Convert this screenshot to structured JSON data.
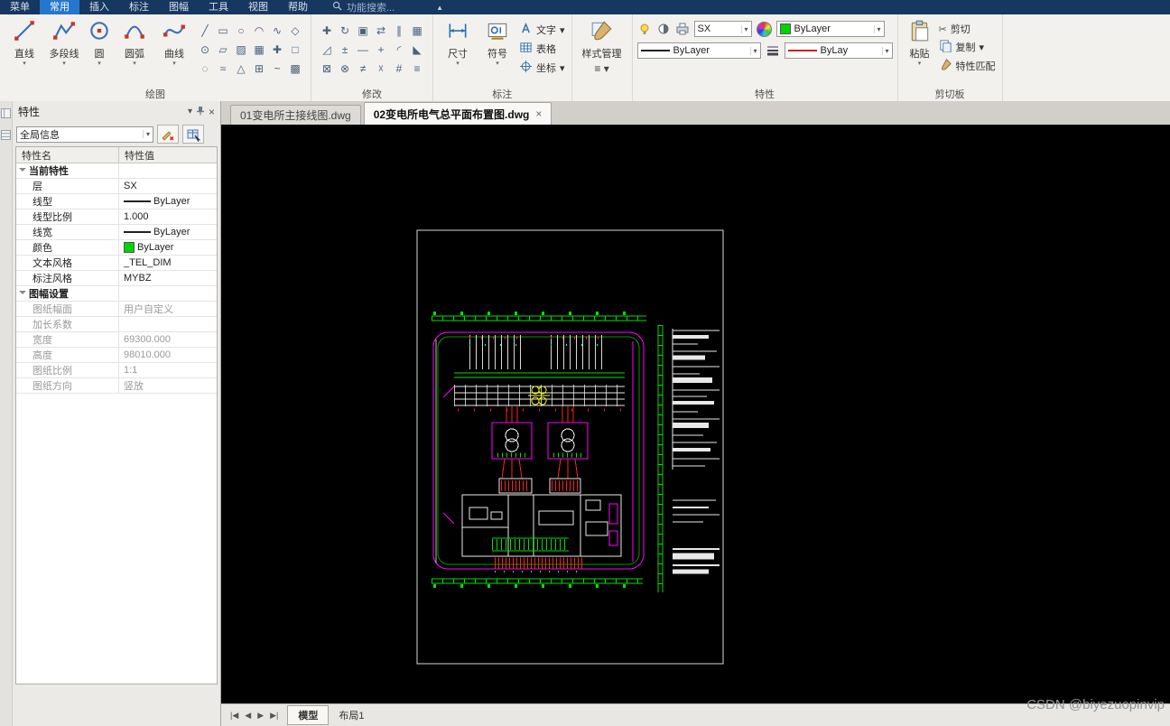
{
  "menubar": {
    "items": [
      {
        "label": "菜单"
      },
      {
        "label": "常用",
        "active": true
      },
      {
        "label": "插入"
      },
      {
        "label": "标注"
      },
      {
        "label": "图幅"
      },
      {
        "label": "工具"
      },
      {
        "label": "视图"
      },
      {
        "label": "帮助"
      }
    ],
    "search_placeholder": "功能搜索..."
  },
  "icons": {
    "dropdown": "▾",
    "close": "×",
    "collapse": "▲",
    "hamburger": "≡",
    "scissors": "✂",
    "nav_first": "|◀",
    "nav_prev": "◀",
    "nav_next": "▶",
    "nav_last": "▶|"
  },
  "ribbon": {
    "draw": {
      "label": "绘图",
      "buttons": [
        {
          "label": "直线"
        },
        {
          "label": "多段线"
        },
        {
          "label": "圆"
        },
        {
          "label": "圆弧"
        },
        {
          "label": "曲线"
        }
      ],
      "tools": [
        {
          "glyph": "╱",
          "name": "construction-line"
        },
        {
          "glyph": "▭",
          "name": "rectangle"
        },
        {
          "glyph": "○",
          "name": "donut"
        },
        {
          "glyph": "◠",
          "name": "revision-cloud"
        },
        {
          "glyph": "∿",
          "name": "spline"
        },
        {
          "glyph": "◇",
          "name": "polygon"
        },
        {
          "glyph": "⊙",
          "name": "point"
        },
        {
          "glyph": "▱",
          "name": "solid"
        },
        {
          "glyph": "▨",
          "name": "hatch"
        },
        {
          "glyph": "▦",
          "name": "table-draw"
        },
        {
          "glyph": "✚",
          "name": "cross-mark"
        },
        {
          "glyph": "□",
          "name": "block"
        },
        {
          "glyph": "◌",
          "name": "ellipse"
        },
        {
          "glyph": "≈",
          "name": "multiline"
        },
        {
          "glyph": "△",
          "name": "wipeout"
        },
        {
          "glyph": "⊞",
          "name": "region"
        },
        {
          "glyph": "~",
          "name": "freehand"
        },
        {
          "glyph": "▩",
          "name": "gradient"
        }
      ]
    },
    "modify": {
      "label": "修改",
      "tools": [
        {
          "glyph": "✚",
          "name": "move"
        },
        {
          "glyph": "↻",
          "name": "rotate"
        },
        {
          "glyph": "▣",
          "name": "copy"
        },
        {
          "glyph": "⇄",
          "name": "mirror"
        },
        {
          "glyph": "∥",
          "name": "offset"
        },
        {
          "glyph": "▦",
          "name": "array"
        },
        {
          "glyph": "◿",
          "name": "chamfer"
        },
        {
          "glyph": "±",
          "name": "lengthen"
        },
        {
          "glyph": "—",
          "name": "trim"
        },
        {
          "glyph": "+",
          "name": "extend"
        },
        {
          "glyph": "◜",
          "name": "fillet"
        },
        {
          "glyph": "◣",
          "name": "scale"
        },
        {
          "glyph": "⊠",
          "name": "erase"
        },
        {
          "glyph": "⊗",
          "name": "break"
        },
        {
          "glyph": "≠",
          "name": "stretch"
        },
        {
          "glyph": "☓",
          "name": "explode"
        },
        {
          "glyph": "#",
          "name": "divide"
        },
        {
          "glyph": "≡",
          "name": "join"
        }
      ]
    },
    "annotate": {
      "label": "标注",
      "dim_label": "尺寸",
      "symbol_label": "符号",
      "text_label": "文字",
      "table_label": "表格",
      "coord_label": "坐标"
    },
    "style_manager_label": "样式管理",
    "properties": {
      "label": "特性",
      "layer_value": "SX",
      "color_value": "ByLayer",
      "linetype_value": "ByLayer",
      "lineweight_value": "ByLay"
    },
    "clipboard": {
      "label": "剪切板",
      "paste_label": "粘贴",
      "cut_label": "剪切",
      "copy_label": "复制",
      "match_label": "特性匹配"
    }
  },
  "palette": {
    "title": "特性",
    "scope_value": "全局信息",
    "header": {
      "name": "特性名",
      "value": "特性值"
    },
    "rows": [
      {
        "type": "group",
        "name": "当前特性"
      },
      {
        "type": "item",
        "name": "层",
        "value": "SX"
      },
      {
        "type": "item",
        "name": "线型",
        "value": "ByLayer",
        "swatch": "line"
      },
      {
        "type": "item",
        "name": "线型比例",
        "value": "1.000"
      },
      {
        "type": "item",
        "name": "线宽",
        "value": "ByLayer",
        "swatch": "line"
      },
      {
        "type": "item",
        "name": "颜色",
        "value": "ByLayer",
        "swatch": "color",
        "swatch_color": "#00d400"
      },
      {
        "type": "item",
        "name": "文本风格",
        "value": "_TEL_DIM"
      },
      {
        "type": "item",
        "name": "标注风格",
        "value": "MYBZ"
      },
      {
        "type": "group",
        "name": "图幅设置"
      },
      {
        "type": "item",
        "name": "图纸幅面",
        "value": "用户自定义",
        "muted": true
      },
      {
        "type": "item",
        "name": "加长系数",
        "value": "",
        "muted": true
      },
      {
        "type": "item",
        "name": "宽度",
        "value": "69300.000",
        "muted": true
      },
      {
        "type": "item",
        "name": "高度",
        "value": "98010.000",
        "muted": true
      },
      {
        "type": "item",
        "name": "图纸比例",
        "value": "1:1",
        "muted": true
      },
      {
        "type": "item",
        "name": "图纸方向",
        "value": "竖放",
        "muted": true
      }
    ]
  },
  "doc_tabs": [
    {
      "label": "01变电所主接线图.dwg",
      "active": false
    },
    {
      "label": "02变电所电气总平面布置图.dwg",
      "active": true
    }
  ],
  "statusbar": {
    "model_tab": "模型",
    "layout_tab": "布局1"
  },
  "watermark": "CSDN @biyezuopinvip",
  "canvas_colors": {
    "background": "#000000",
    "paper": "#e8e8e8",
    "fence": "#00e000",
    "boundary": "#ff00ff",
    "feeder": "#ff2222",
    "highlight": "#ffff00"
  }
}
